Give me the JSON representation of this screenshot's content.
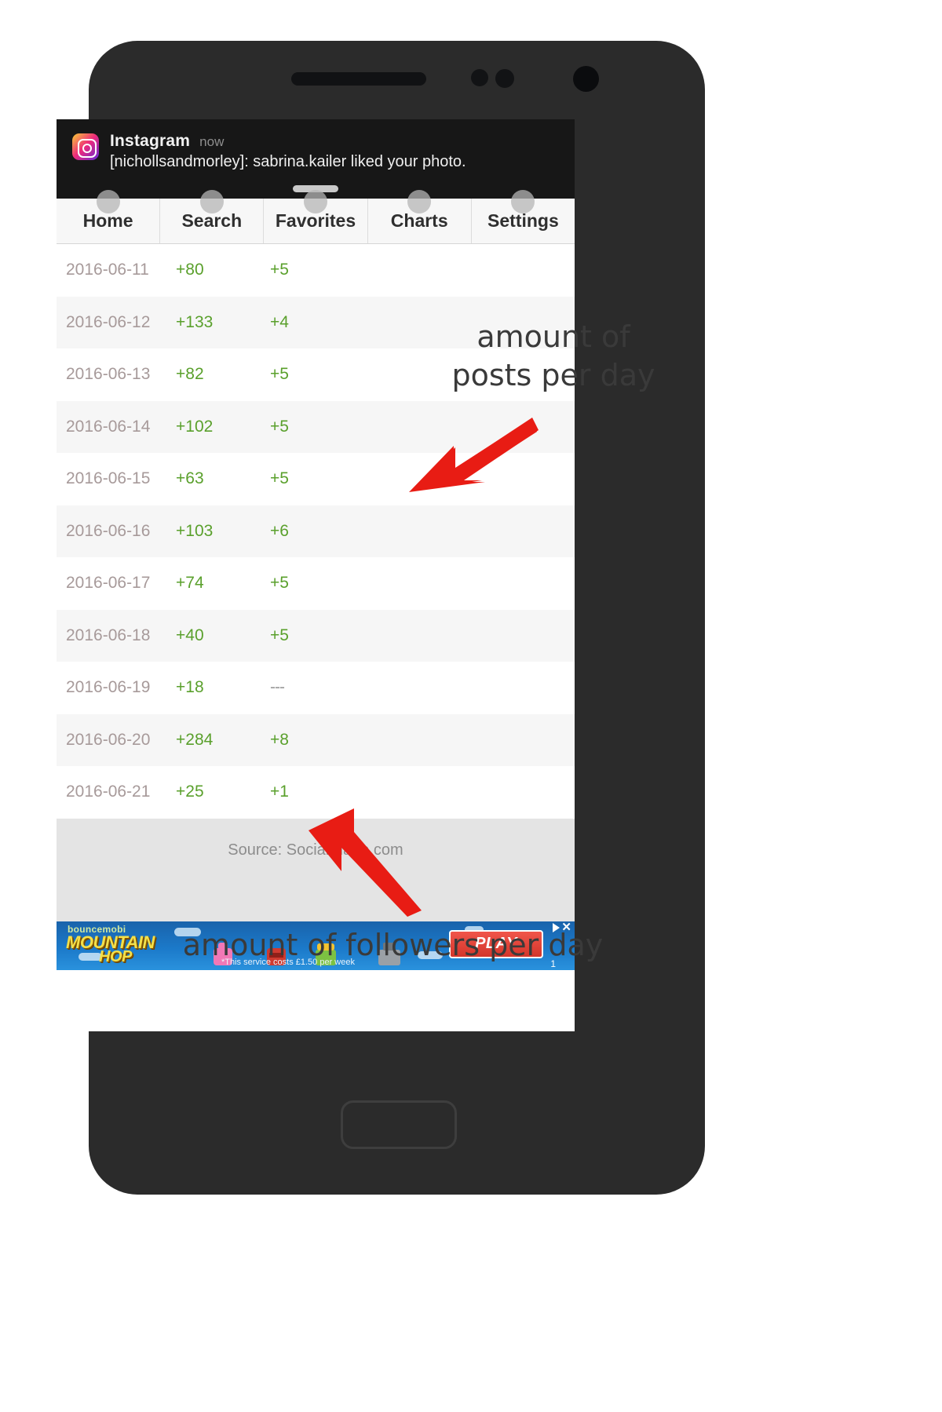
{
  "notification": {
    "app": "Instagram",
    "time": "now",
    "body": "[nichollsandmorley]: sabrina.kailer liked your photo.",
    "icon": "instagram-icon"
  },
  "tabs": [
    {
      "label": "Home",
      "name": "tab-home"
    },
    {
      "label": "Search",
      "name": "tab-search"
    },
    {
      "label": "Favorites",
      "name": "tab-favorites"
    },
    {
      "label": "Charts",
      "name": "tab-charts"
    },
    {
      "label": "Settings",
      "name": "tab-settings"
    }
  ],
  "table": {
    "rows": [
      {
        "date": "2016-06-11",
        "followers": "+80",
        "posts": "+5"
      },
      {
        "date": "2016-06-12",
        "followers": "+133",
        "posts": "+4"
      },
      {
        "date": "2016-06-13",
        "followers": "+82",
        "posts": "+5"
      },
      {
        "date": "2016-06-14",
        "followers": "+102",
        "posts": "+5"
      },
      {
        "date": "2016-06-15",
        "followers": "+63",
        "posts": "+5"
      },
      {
        "date": "2016-06-16",
        "followers": "+103",
        "posts": "+6"
      },
      {
        "date": "2016-06-17",
        "followers": "+74",
        "posts": "+5"
      },
      {
        "date": "2016-06-18",
        "followers": "+40",
        "posts": "+5"
      },
      {
        "date": "2016-06-19",
        "followers": "+18",
        "posts": "---"
      },
      {
        "date": "2016-06-20",
        "followers": "+284",
        "posts": "+8"
      },
      {
        "date": "2016-06-21",
        "followers": "+25",
        "posts": "+1"
      }
    ]
  },
  "footer": {
    "source": "Source: SocialBlade.com"
  },
  "ad": {
    "brand": "bouncemobi",
    "title_line1": "MOUNTAIN",
    "title_line2": "HOP",
    "disclaimer": "*This service costs £1.50 per week",
    "cta": "PLAY",
    "counter": "1"
  },
  "annotations": {
    "posts": "amount of\nposts per day",
    "posts_line1": "amount of",
    "posts_line2": "posts per day",
    "followers": "amount of followers per day",
    "arrow_color": "#e81c14"
  },
  "colors": {
    "accent_green": "#5aa02c",
    "date_gray": "#a79a9a",
    "arrow_red": "#e81c14",
    "phone_body": "#2b2b2b",
    "notif_bg": "#171717"
  }
}
